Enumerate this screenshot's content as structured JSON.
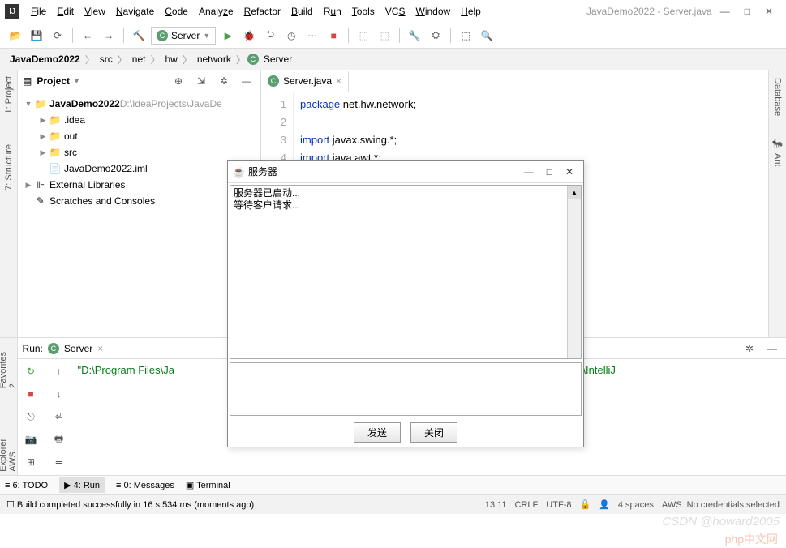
{
  "window": {
    "title": "JavaDemo2022 - Server.java",
    "minimize": "—",
    "maximize": "□",
    "close": "✕"
  },
  "menu": [
    "File",
    "Edit",
    "View",
    "Navigate",
    "Code",
    "Analyze",
    "Refactor",
    "Build",
    "Run",
    "Tools",
    "VCS",
    "Window",
    "Help"
  ],
  "run_config": "Server",
  "breadcrumb": [
    "JavaDemo2022",
    "src",
    "net",
    "hw",
    "network",
    "Server"
  ],
  "project_panel": {
    "title": "Project",
    "tree": [
      {
        "indent": 0,
        "arrow": "▼",
        "icon": "folder-blue",
        "label": "JavaDemo2022",
        "dim": "D:\\IdeaProjects\\JavaDe"
      },
      {
        "indent": 1,
        "arrow": "▶",
        "icon": "folder",
        "label": ".idea",
        "dim": ""
      },
      {
        "indent": 1,
        "arrow": "▶",
        "icon": "folder",
        "label": "out",
        "dim": ""
      },
      {
        "indent": 1,
        "arrow": "▶",
        "icon": "folder-blue",
        "label": "src",
        "dim": ""
      },
      {
        "indent": 1,
        "arrow": "",
        "icon": "file",
        "label": "JavaDemo2022.iml",
        "dim": ""
      },
      {
        "indent": 0,
        "arrow": "▶",
        "icon": "lib",
        "label": "External Libraries",
        "dim": ""
      },
      {
        "indent": 0,
        "arrow": "",
        "icon": "scratch",
        "label": "Scratches and Consoles",
        "dim": ""
      }
    ]
  },
  "left_tabs": [
    "1: Project",
    "7: Structure"
  ],
  "left_tabs2": [
    "2: Favorites",
    "AWS Explorer"
  ],
  "right_tabs": [
    "Database",
    "Ant"
  ],
  "editor": {
    "tab": "Server.java",
    "lines": [
      {
        "n": "1",
        "pre": "",
        "kw": "package",
        "post": " net.hw.network;"
      },
      {
        "n": "2",
        "pre": "",
        "kw": "",
        "post": ""
      },
      {
        "n": "3",
        "pre": "",
        "kw": "import",
        "post": " javax.swing.*;"
      },
      {
        "n": "4",
        "pre": "",
        "kw": "import",
        "post": " java.awt.*;"
      }
    ]
  },
  "run": {
    "label": "Run:",
    "tab": "Server",
    "output": "\"D:\\Program Files\\Ja",
    "output_right": "am Files\\JetBrains\\IntelliJ"
  },
  "bottom_tabs": [
    "6: TODO",
    "4: Run",
    "0: Messages",
    "Terminal"
  ],
  "status": {
    "left": "Build completed successfully in 16 s 534 ms (moments ago)",
    "time": "13:11",
    "eol": "CRLF",
    "enc": "UTF-8",
    "indent": "4 spaces",
    "aws": "AWS: No credentials selected"
  },
  "dialog": {
    "title": "服务器",
    "text_lines": [
      "服务器已启动...",
      "等待客户请求..."
    ],
    "btn_send": "发送",
    "btn_close": "关闭"
  },
  "watermark": "CSDN @howard2005",
  "watermark2": "php中文网"
}
